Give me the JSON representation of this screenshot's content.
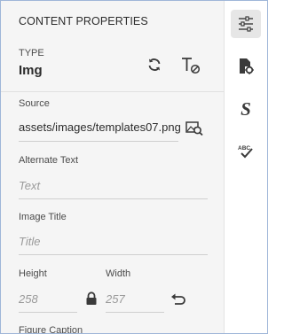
{
  "panel": {
    "heading": "CONTENT PROPERTIES",
    "type": {
      "label": "TYPE",
      "value": "Img"
    },
    "source": {
      "label": "Source",
      "value": "assets/images/templates07.png"
    },
    "alt_text": {
      "label": "Alternate Text",
      "placeholder": "Text"
    },
    "image_title": {
      "label": "Image Title",
      "placeholder": "Title"
    },
    "height": {
      "label": "Height",
      "placeholder": "258"
    },
    "width": {
      "label": "Width",
      "placeholder": "257"
    },
    "figure_caption": {
      "label": "Figure Caption"
    }
  },
  "icons": {
    "type_actions": [
      "refresh-icon",
      "clear-formatting-icon"
    ],
    "source_action": "browse-image-icon",
    "dimension_actions": [
      "lock-icon",
      "reset-icon"
    ],
    "rail": [
      "properties-sliders-icon",
      "document-settings-icon",
      "style-icon",
      "spellcheck-icon"
    ]
  }
}
